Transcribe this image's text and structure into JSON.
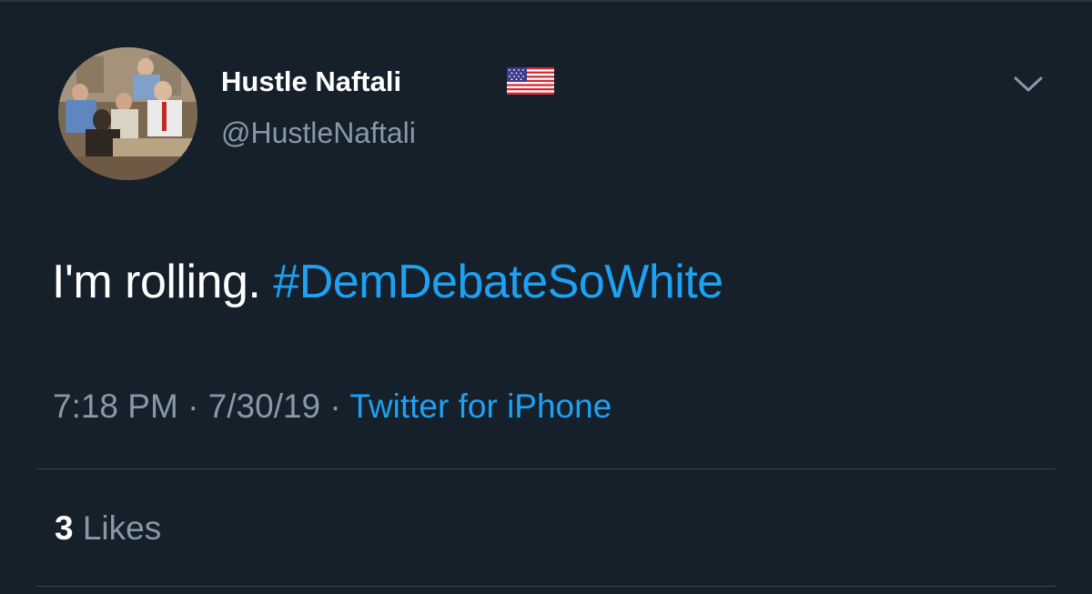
{
  "tweet": {
    "author": {
      "display_name": "Hustle Naftali",
      "handle": "@HustleNaftali",
      "flag_icon": "us-flag-icon"
    },
    "text_plain": "I'm rolling.",
    "hashtag": "#DemDebateSoWhite",
    "time": "7:18 PM",
    "separator": "·",
    "date": "7/30/19",
    "source": "Twitter for iPhone",
    "likes_count": "3",
    "likes_label": "Likes"
  },
  "colors": {
    "background": "#15202b",
    "text": "#ffffff",
    "secondary": "#8899a6",
    "accent": "#1da1f2",
    "divider": "#38444d"
  }
}
